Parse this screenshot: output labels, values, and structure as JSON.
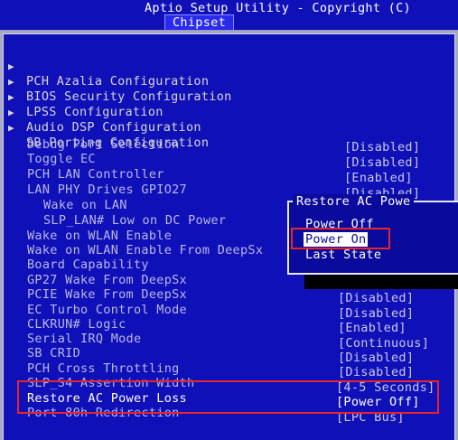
{
  "header": {
    "title": "Aptio Setup Utility - Copyright (C)",
    "active_tab": "Chipset"
  },
  "submenus": [
    {
      "label": "PCH Azalia Configuration"
    },
    {
      "label": "BIOS Security Configuration"
    },
    {
      "label": "LPSS Configuration"
    },
    {
      "label": "Audio DSP Configuration"
    },
    {
      "label": "SB Porting Configuration"
    }
  ],
  "settings": [
    {
      "label": "Debug Port Selection",
      "value": "[Disabled]"
    },
    {
      "label": "Toggle EC",
      "value": "[Disabled]"
    },
    {
      "label": "PCH LAN Controller",
      "value": "[Enabled]"
    },
    {
      "label": "LAN PHY Drives GPIO27",
      "value": "[Disabled]"
    },
    {
      "label": "Wake on LAN",
      "value": ""
    },
    {
      "label": "SLP_LAN# Low on DC Power",
      "value": ""
    },
    {
      "label": "Wake on WLAN Enable",
      "value": ""
    },
    {
      "label": "Wake on WLAN Enable From DeepSx",
      "value": ""
    },
    {
      "label": "Board Capability",
      "value": ""
    },
    {
      "label": "GP27 Wake From DeepSx",
      "value": ""
    },
    {
      "label": "PCIE Wake From DeepSx",
      "value": "[Disabled]"
    },
    {
      "label": "EC Turbo Control Mode",
      "value": "[Disabled]"
    },
    {
      "label": "CLKRUN# Logic",
      "value": "[Enabled]"
    },
    {
      "label": "Serial IRQ Mode",
      "value": "[Continuous]"
    },
    {
      "label": "SB CRID",
      "value": "[Disabled]"
    },
    {
      "label": "PCH Cross Throttling",
      "value": "[Disabled]"
    },
    {
      "label": "SLP_S4 Assertion Width",
      "value": "[4-5 Seconds]"
    },
    {
      "label": "Restore AC Power Loss",
      "value": "[Power Off]"
    },
    {
      "label": "Port 80h Redirection",
      "value": "[LPC Bus]"
    }
  ],
  "popup": {
    "title": "Restore AC Powe",
    "options": [
      "Power Off",
      "Power On",
      "Last State"
    ],
    "selected_option": "Power On"
  },
  "colors": {
    "background": "#1010b8",
    "annotation": "#e8232a",
    "selected_bg": "#ffffff"
  }
}
